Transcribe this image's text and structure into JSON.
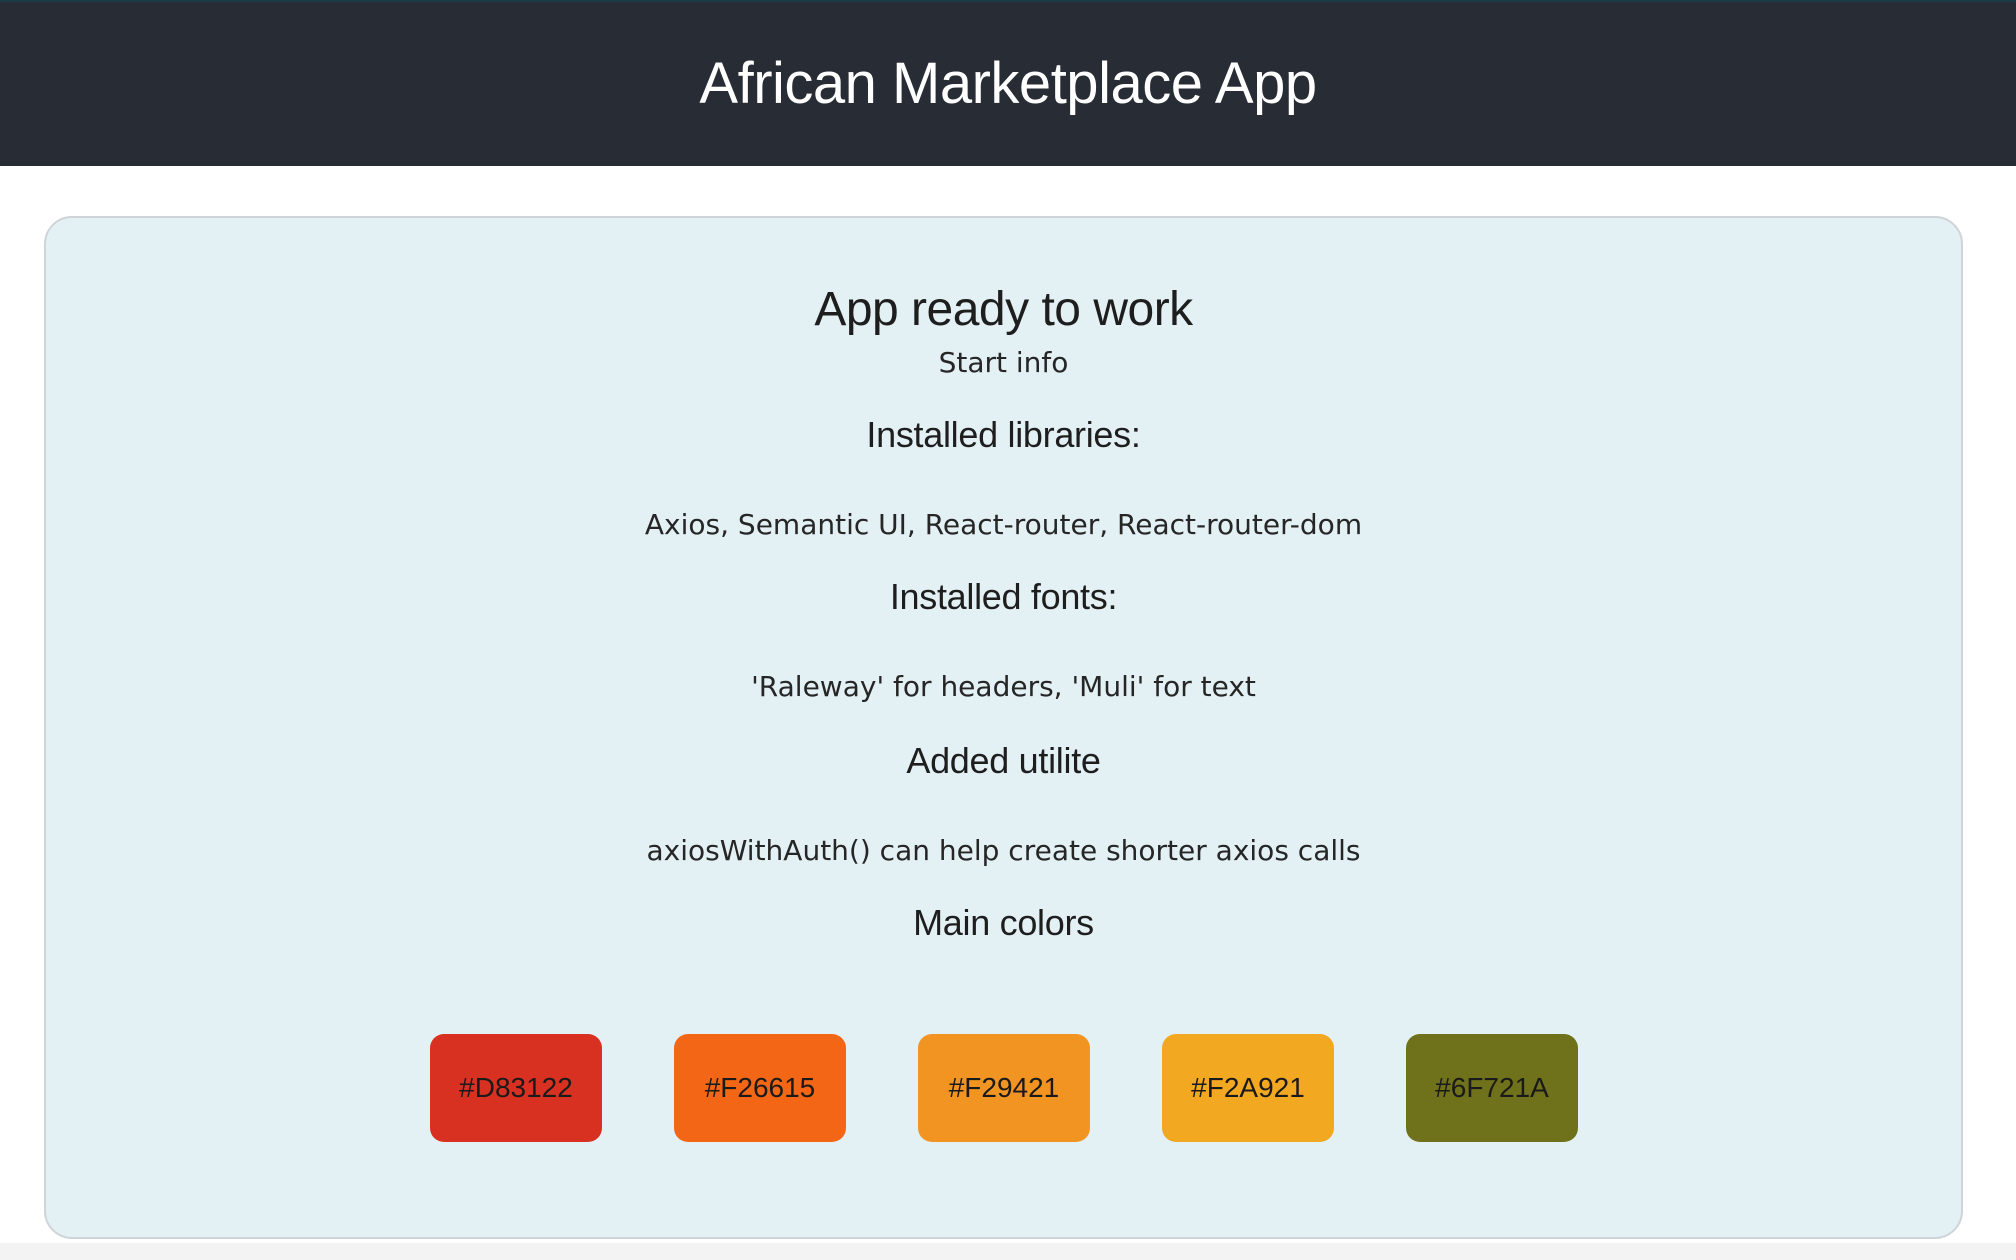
{
  "header": {
    "title": "African Marketplace App"
  },
  "main": {
    "heading": "App ready to work",
    "subheading": "Start info",
    "sections": [
      {
        "title": "Installed libraries:",
        "text": "Axios, Semantic UI, React-router, React-router-dom"
      },
      {
        "title": "Installed fonts:",
        "text": "'Raleway' for headers, 'Muli' for text"
      },
      {
        "title": "Added utilite",
        "text": "axiosWithAuth() can help create shorter axios calls"
      }
    ],
    "colors_title": "Main colors",
    "colors": [
      {
        "label": "#D83122",
        "hex": "#D83122"
      },
      {
        "label": "#F26615",
        "hex": "#F26615"
      },
      {
        "label": "#F29421",
        "hex": "#F29421"
      },
      {
        "label": "#F2A921",
        "hex": "#F2A921"
      },
      {
        "label": "#6F721A",
        "hex": "#6F721A"
      }
    ]
  },
  "theme": {
    "header_bg": "#272c35",
    "card_bg": "#e3f0f4"
  }
}
